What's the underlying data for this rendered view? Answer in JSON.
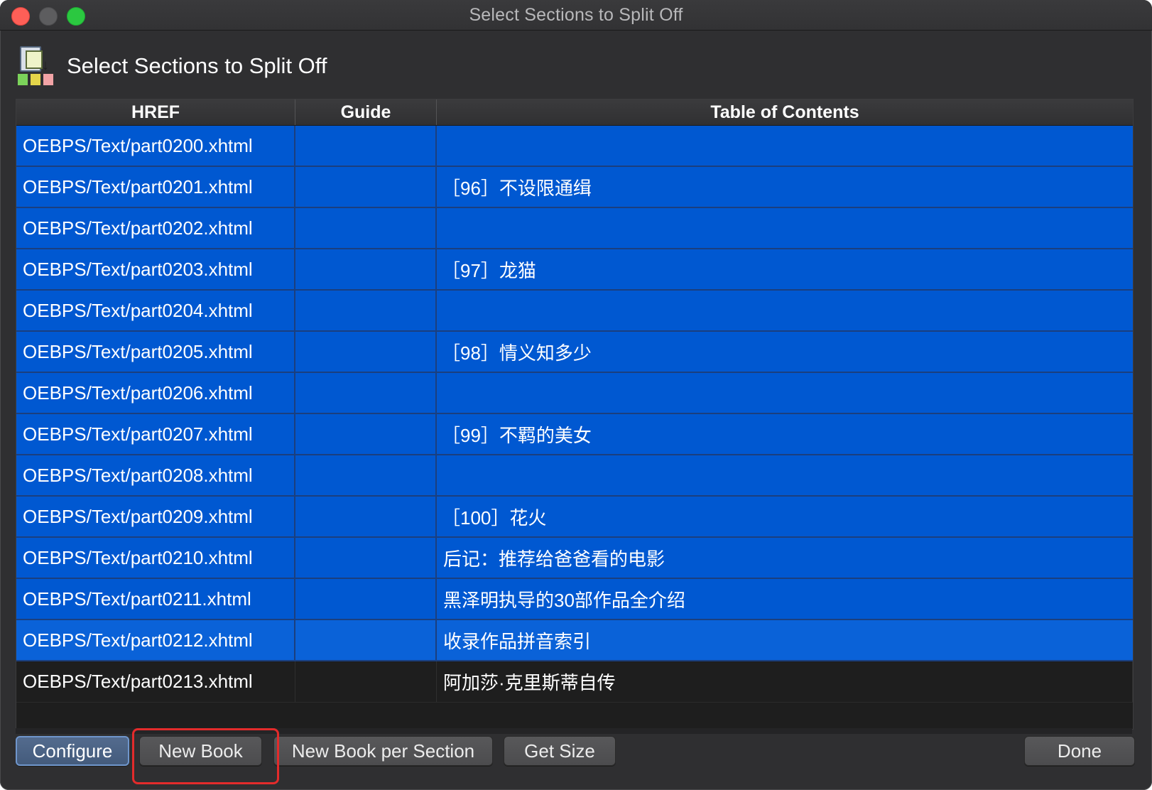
{
  "window": {
    "title": "Select Sections to Split Off"
  },
  "header": {
    "title": "Select Sections to Split Off",
    "icon": "split-book-icon"
  },
  "table": {
    "columns": [
      "HREF",
      "Guide",
      "Table of Contents"
    ],
    "rows": [
      {
        "href": "OEBPS/Text/part0200.xhtml",
        "guide": "",
        "toc": ""
      },
      {
        "href": "OEBPS/Text/part0201.xhtml",
        "guide": "",
        "toc": "［96］不设限通缉"
      },
      {
        "href": "OEBPS/Text/part0202.xhtml",
        "guide": "",
        "toc": ""
      },
      {
        "href": "OEBPS/Text/part0203.xhtml",
        "guide": "",
        "toc": "［97］龙猫"
      },
      {
        "href": "OEBPS/Text/part0204.xhtml",
        "guide": "",
        "toc": ""
      },
      {
        "href": "OEBPS/Text/part0205.xhtml",
        "guide": "",
        "toc": "［98］情义知多少"
      },
      {
        "href": "OEBPS/Text/part0206.xhtml",
        "guide": "",
        "toc": ""
      },
      {
        "href": "OEBPS/Text/part0207.xhtml",
        "guide": "",
        "toc": "［99］不羁的美女"
      },
      {
        "href": "OEBPS/Text/part0208.xhtml",
        "guide": "",
        "toc": ""
      },
      {
        "href": "OEBPS/Text/part0209.xhtml",
        "guide": "",
        "toc": "［100］花火"
      },
      {
        "href": "OEBPS/Text/part0210.xhtml",
        "guide": "",
        "toc": "后记：推荐给爸爸看的电影"
      },
      {
        "href": "OEBPS/Text/part0211.xhtml",
        "guide": "",
        "toc": "黑泽明执导的30部作品全介绍"
      },
      {
        "href": "OEBPS/Text/part0212.xhtml",
        "guide": "",
        "toc": "收录作品拼音索引"
      },
      {
        "href": "OEBPS/Text/part0213.xhtml",
        "guide": "",
        "toc": "阿加莎·克里斯蒂自传"
      }
    ]
  },
  "buttons": {
    "configure": "Configure",
    "new_book": "New Book",
    "new_book_per_section": "New Book per Section",
    "get_size": "Get Size",
    "done": "Done"
  },
  "colors": {
    "selection": "#0058d1",
    "highlight_box": "#e32b2b"
  }
}
